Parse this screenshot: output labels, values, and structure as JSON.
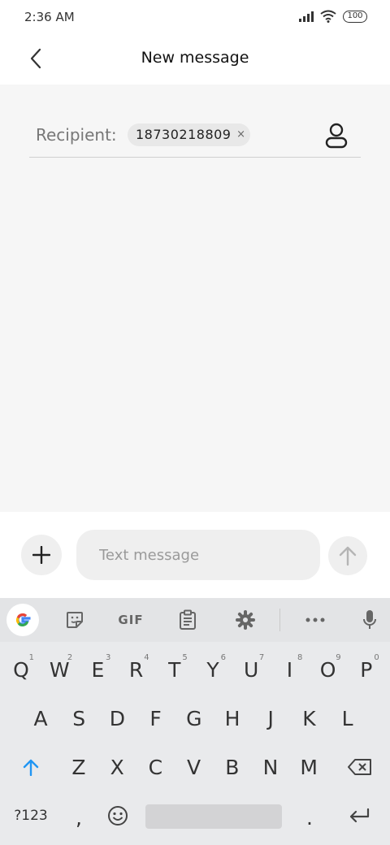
{
  "status_bar": {
    "time": "2:36 AM",
    "battery": "100"
  },
  "header": {
    "title": "New message"
  },
  "recipient": {
    "label": "Recipient:",
    "number": "18730218809",
    "remove_glyph": "×"
  },
  "compose": {
    "placeholder": "Text message"
  },
  "keyboard": {
    "toolbar_gif": "GIF",
    "row1": [
      {
        "key": "Q",
        "hint": "1"
      },
      {
        "key": "W",
        "hint": "2"
      },
      {
        "key": "E",
        "hint": "3"
      },
      {
        "key": "R",
        "hint": "4"
      },
      {
        "key": "T",
        "hint": "5"
      },
      {
        "key": "Y",
        "hint": "6"
      },
      {
        "key": "U",
        "hint": "7"
      },
      {
        "key": "I",
        "hint": "8"
      },
      {
        "key": "O",
        "hint": "9"
      },
      {
        "key": "P",
        "hint": "0"
      }
    ],
    "row2": [
      "A",
      "S",
      "D",
      "F",
      "G",
      "H",
      "J",
      "K",
      "L"
    ],
    "row3": [
      "Z",
      "X",
      "C",
      "V",
      "B",
      "N",
      "M"
    ],
    "symbols_key": "?123",
    "comma_key": ",",
    "period_key": "."
  },
  "icons": {
    "back": "chevron-left-icon",
    "contact": "person-icon",
    "add": "plus-icon",
    "send": "arrow-up-icon",
    "google": "google-icon",
    "sticker": "sticker-icon",
    "clipboard": "clipboard-icon",
    "settings": "gear-icon",
    "more": "more-icon",
    "mic": "mic-icon",
    "shift": "shift-icon",
    "backspace": "backspace-icon",
    "emoji": "emoji-icon",
    "enter": "enter-icon"
  },
  "colors": {
    "accent": "#2196f3",
    "content_bg": "#f6f6f6",
    "keyboard_bg": "#e9eaec"
  }
}
